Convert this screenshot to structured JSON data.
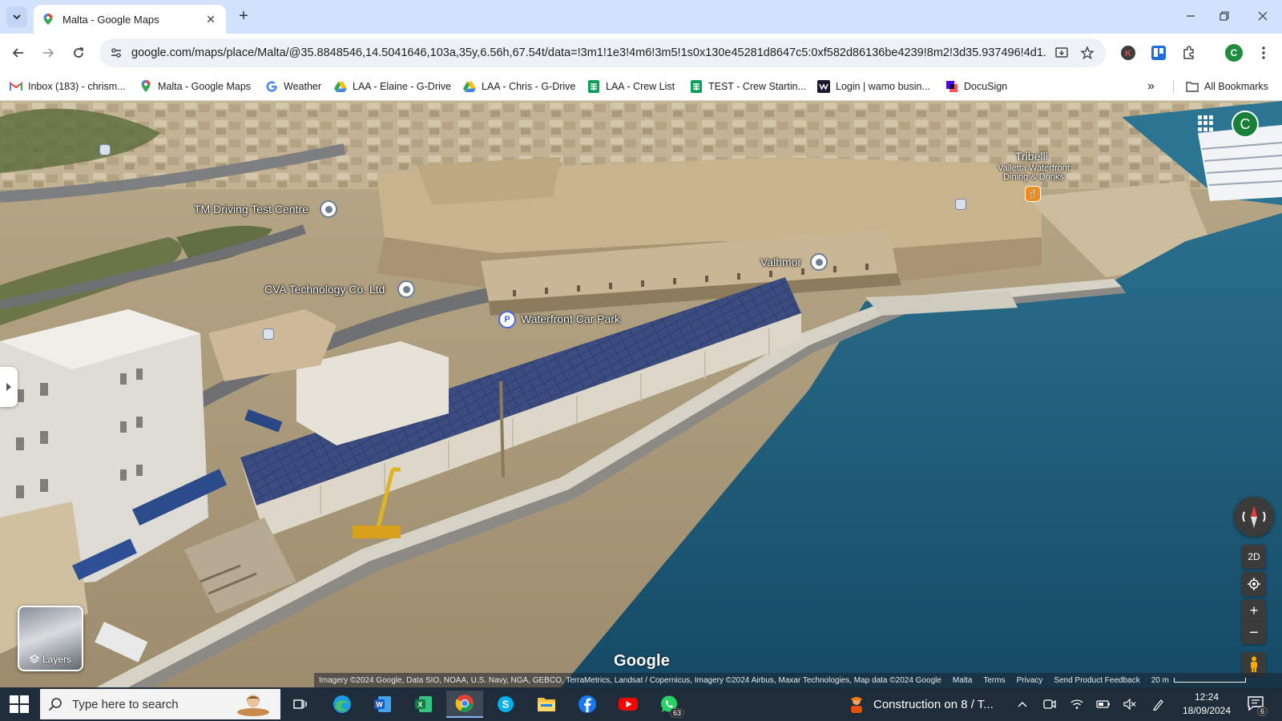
{
  "browser": {
    "tab": {
      "title": "Malta - Google Maps",
      "favicon": "google-maps-pin-icon"
    },
    "new_tab_label": "+",
    "url": "google.com/maps/place/Malta/@35.8848546,14.5041646,103a,35y,6.56h,67.54t/data=!3m1!1e3!4m6!3m5!1s0x130e45281d8647c5:0xf582d86136be4239!8m2!3d35.937496!4d1...",
    "profile_initial": "C",
    "bookmarks": [
      {
        "label": "Inbox (183) - chrism...",
        "icon": "gmail-icon"
      },
      {
        "label": "Malta - Google Maps",
        "icon": "google-maps-pin-icon"
      },
      {
        "label": "Weather",
        "icon": "google-g-icon"
      },
      {
        "label": "LAA - Elaine - G-Drive",
        "icon": "google-drive-icon"
      },
      {
        "label": "LAA - Chris - G-Drive",
        "icon": "google-drive-icon"
      },
      {
        "label": "LAA - Crew List",
        "icon": "google-sheets-icon"
      },
      {
        "label": "TEST - Crew Startin...",
        "icon": "google-sheets-icon"
      },
      {
        "label": "Login | wamo busin...",
        "icon": "wamo-icon"
      },
      {
        "label": "DocuSign",
        "icon": "docusign-icon"
      }
    ],
    "overflow_label": "»",
    "all_bookmarks_label": "All Bookmarks"
  },
  "map": {
    "places": {
      "tm_driving": "TM Driving Test Centre",
      "cva": "CVA Technology Co. Ltd",
      "car_park": "Waterfront Car Park",
      "car_park_badge": "P",
      "valhmor": "Valhmor",
      "tribelli": "Tribelli",
      "tribelli_sub": "Valletta Waterfront Dining & Drinks"
    },
    "account_initial": "C",
    "layers_label": "Layers",
    "controls": {
      "two_d": "2D",
      "zoom_in": "+",
      "zoom_out": "−"
    },
    "wordmark": "Google",
    "attribution": {
      "imagery": "Imagery ©2024 Google, Data SIO, NOAA, U.S. Navy, NGA, GEBCO, TerraMetrics, Landsat / Copernicus, Imagery ©2024 Airbus, Maxar Technologies, Map data ©2024 Google",
      "region": "Malta",
      "terms": "Terms",
      "privacy": "Privacy",
      "feedback": "Send Product Feedback",
      "scale": "20 m"
    }
  },
  "taskbar": {
    "search_placeholder": "Type here to search",
    "apps": [
      "task-view",
      "edge",
      "word",
      "excel",
      "chrome",
      "skype",
      "file-explorer",
      "facebook",
      "youtube",
      "whatsapp"
    ],
    "whatsapp_badge": "63",
    "news_text": "Construction on 8 / T...",
    "time": "12:24",
    "date": "18/09/2024",
    "notification_count": "6"
  },
  "colors": {
    "sea": "#1a5573",
    "chrome_blue": "#d3e3fd",
    "taskbar": "#1f2c3a"
  }
}
